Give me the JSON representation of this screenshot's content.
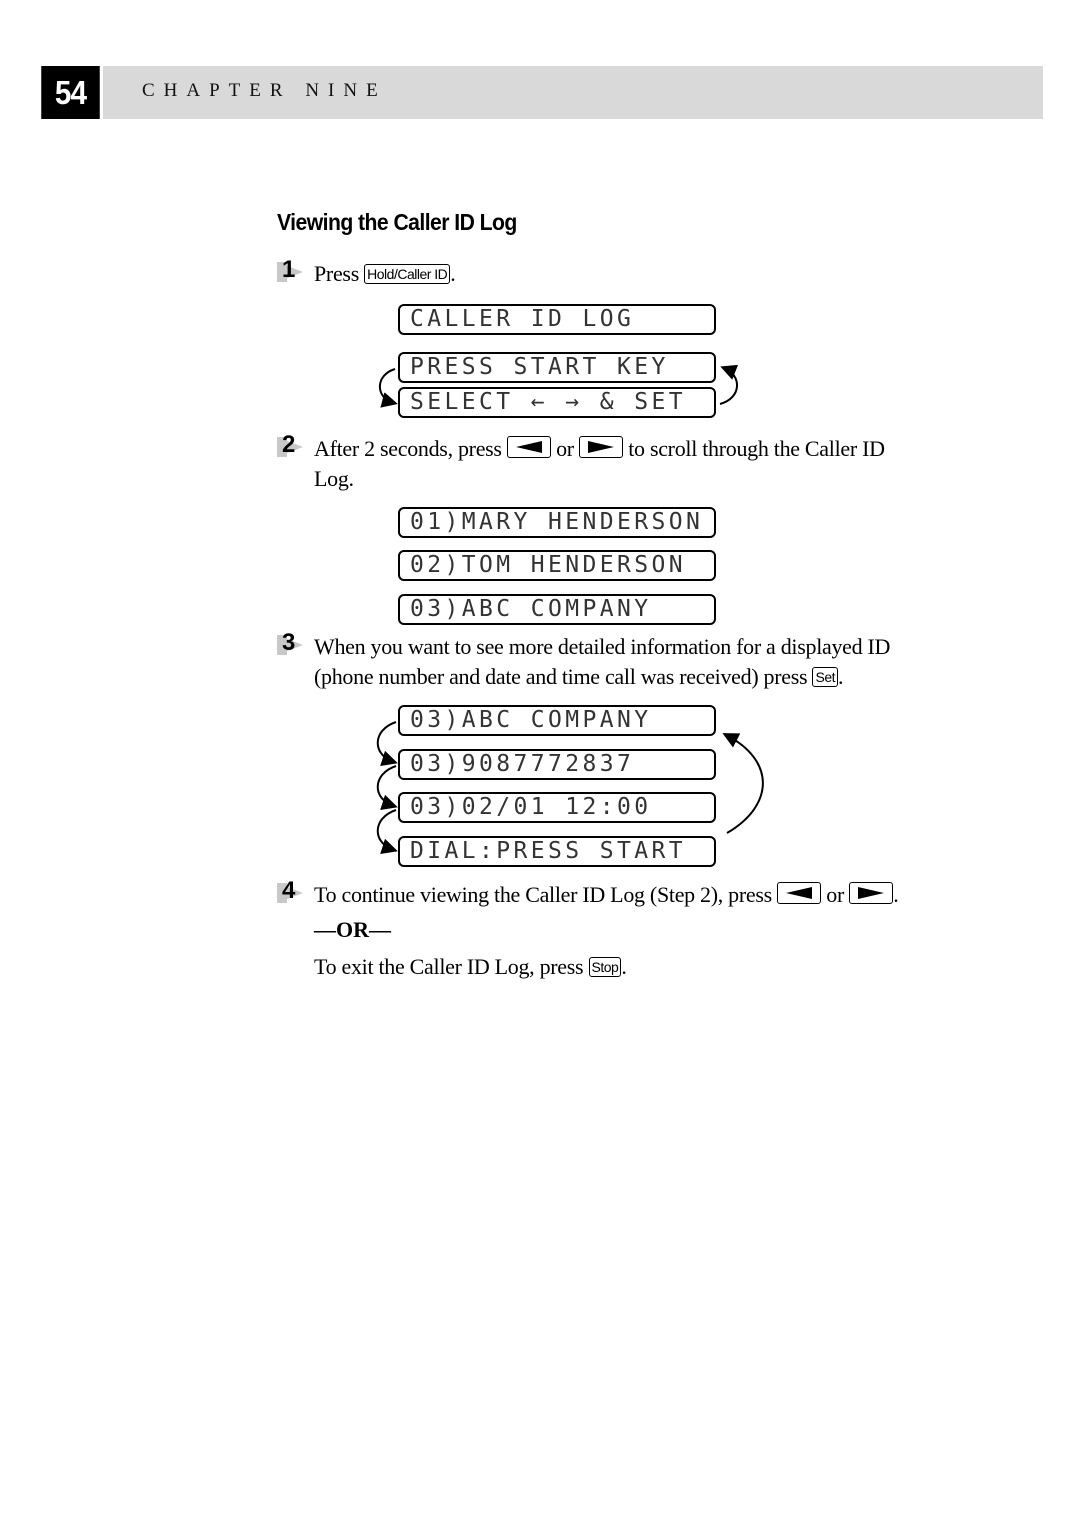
{
  "header": {
    "page_number": "54",
    "chapter": "CHAPTER NINE"
  },
  "section": {
    "title": "Viewing the Caller ID Log"
  },
  "steps": [
    {
      "number": "1",
      "text_before": "Press ",
      "key": "Hold/Caller ID",
      "text_after": ".",
      "displays": [
        "CALLER ID LOG",
        "PRESS START KEY",
        "SELECT ← → & SET"
      ]
    },
    {
      "number": "2",
      "text_before": "After 2 seconds, press ",
      "left_key": "left-arrow-key",
      "text_mid": " or ",
      "right_key": "right-arrow-key",
      "text_after": " to scroll through the Caller ID",
      "text_line2": "Log.",
      "displays": [
        "01)MARY HENDERSON",
        "02)TOM HENDERSON",
        "03)ABC COMPANY"
      ]
    },
    {
      "number": "3",
      "text_line1": "When you want to see more detailed information for a displayed ID",
      "text_line2_before": "(phone number and date and time call was received) press ",
      "key": "Set",
      "text_after": ".",
      "displays": [
        "03)ABC COMPANY",
        "03)9087772837",
        "03)02/01 12:00",
        "DIAL:PRESS START"
      ]
    },
    {
      "number": "4",
      "text_before": "To continue viewing the Caller ID Log (Step 2), press ",
      "text_mid": " or ",
      "text_after": ".",
      "or_label": "—OR—",
      "alt_before": "To exit the Caller ID Log, press ",
      "alt_key": "Stop",
      "alt_after": "."
    }
  ]
}
